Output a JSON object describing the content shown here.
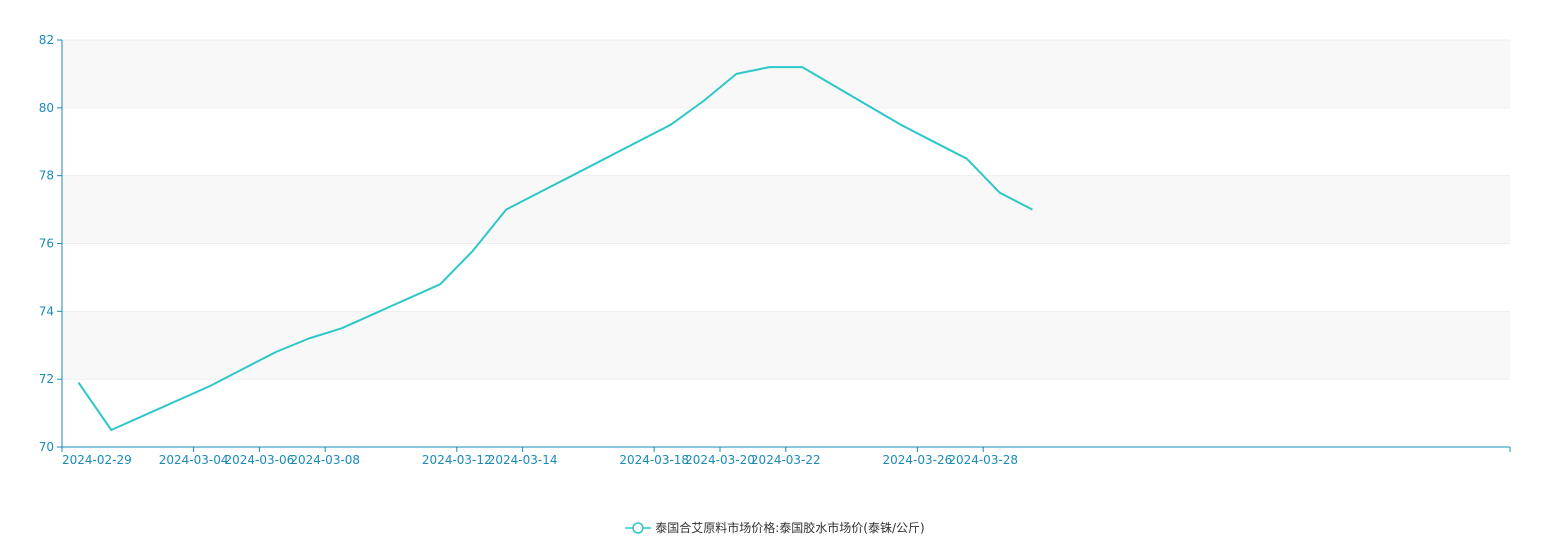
{
  "chart_data": {
    "type": "line",
    "x": [
      "2024-02-29",
      "2024-03-01",
      "2024-03-04",
      "2024-03-05",
      "2024-03-06",
      "2024-03-07",
      "2024-03-08",
      "2024-03-11",
      "2024-03-12",
      "2024-03-13",
      "2024-03-14",
      "2024-03-15",
      "2024-03-18",
      "2024-03-19",
      "2024-03-20",
      "2024-03-21",
      "2024-03-22",
      "2024-03-25",
      "2024-03-26",
      "2024-03-27",
      "2024-03-28",
      "2024-03-29"
    ],
    "series": [
      {
        "name": "泰国合艾原料市场价格:泰国胶水市场价(泰铢/公斤)",
        "values": [
          71.9,
          70.5,
          71.8,
          72.3,
          72.8,
          73.2,
          73.5,
          74.8,
          75.8,
          77.0,
          77.5,
          78.0,
          79.5,
          80.2,
          81.0,
          81.2,
          81.2,
          79.5,
          79.0,
          78.5,
          77.5,
          77.0
        ],
        "color": "#2ec7c9"
      }
    ],
    "x_tick_labels": [
      "2024-02-29",
      "2024-03-04",
      "2024-03-06",
      "2024-03-08",
      "2024-03-12",
      "2024-03-14",
      "2024-03-18",
      "2024-03-20",
      "2024-03-22",
      "2024-03-26",
      "2024-03-28"
    ],
    "y_ticks": [
      70,
      72,
      74,
      76,
      78,
      80,
      82
    ],
    "ylim": [
      70,
      82
    ],
    "title": "",
    "xlabel": "",
    "ylabel": "",
    "grid": true,
    "legend_position": "bottom-center",
    "colors": {
      "axis": "#1a8bb8",
      "band": "#f8f8f8",
      "grid": "#eeeeee"
    }
  }
}
